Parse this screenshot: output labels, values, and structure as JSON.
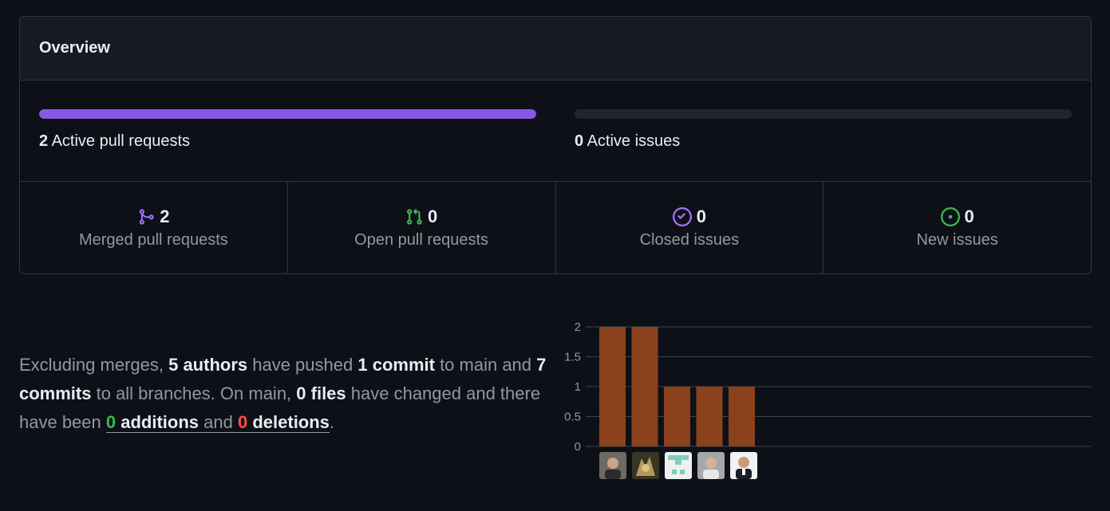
{
  "overview": {
    "title": "Overview",
    "pull_requests": {
      "count": "2",
      "label": "Active pull requests",
      "fill": 1.0
    },
    "issues": {
      "count": "0",
      "label": "Active issues",
      "fill": 0.0
    }
  },
  "stats": [
    {
      "icon": "git-merge-icon",
      "value": "2",
      "label": "Merged pull requests",
      "color": "#a371f7"
    },
    {
      "icon": "git-pull-request-icon",
      "value": "0",
      "label": "Open pull requests",
      "color": "#3fb950"
    },
    {
      "icon": "issue-closed-icon",
      "value": "0",
      "label": "Closed issues",
      "color": "#a371f7"
    },
    {
      "icon": "issue-opened-icon",
      "value": "0",
      "label": "New issues",
      "color": "#3fb950"
    }
  ],
  "summary": {
    "t1": "Excluding merges, ",
    "authors": "5 authors",
    "t2": " have pushed ",
    "commit": "1 commit",
    "t3": " to main and ",
    "commits_all": "7 commits",
    "t4": " to all branches. On main, ",
    "files": "0 files",
    "t5": " have changed and there have been ",
    "additions_num": "0",
    "additions_word": "additions",
    "and_word": " and ",
    "deletions_num": "0",
    "deletions_word": "deletions",
    "period": "."
  },
  "chart_data": {
    "type": "bar",
    "categories": [
      "contributor-1",
      "contributor-2",
      "contributor-3",
      "contributor-4",
      "contributor-5"
    ],
    "values": [
      2,
      2,
      1,
      1,
      1
    ],
    "ylim": [
      0,
      2
    ],
    "yticks": [
      "0",
      "0.5",
      "1",
      "1.5",
      "2"
    ],
    "bar_color": "#8b411c",
    "grid": true
  },
  "colors": {
    "accent": "#8957e5",
    "green": "#3fb950",
    "red": "#f85149",
    "bar": "#8b411c"
  }
}
